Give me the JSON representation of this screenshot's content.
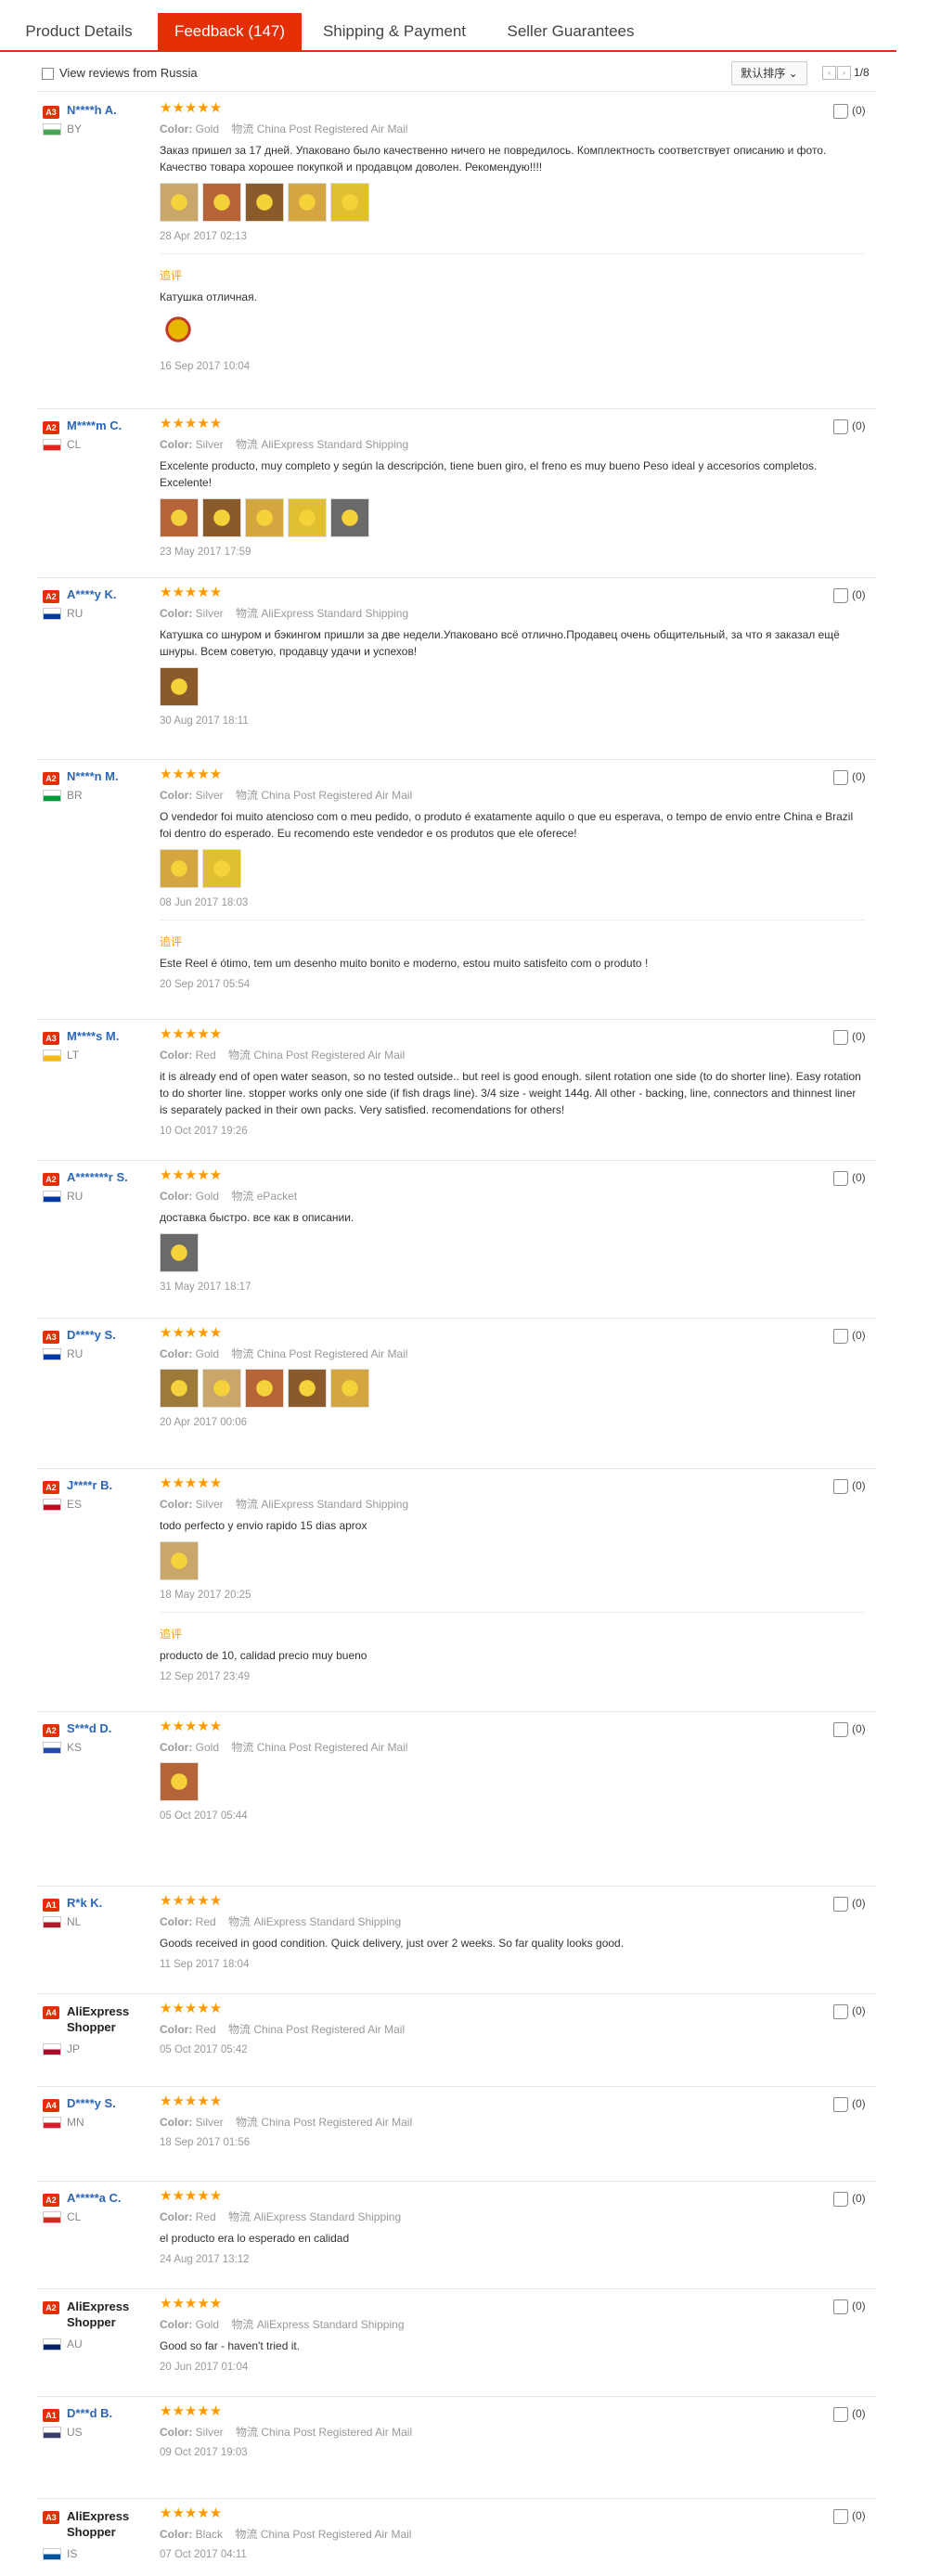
{
  "tabs": [
    {
      "label": "Product Details"
    },
    {
      "label": "Feedback (147)"
    },
    {
      "label": "Shipping & Payment"
    },
    {
      "label": "Seller Guarantees"
    }
  ],
  "toolbar": {
    "filter_label": "View reviews from Russia",
    "sort_label": "默认排序",
    "page_text": "1/8",
    "prev": "‹",
    "next": "›"
  },
  "labels": {
    "color": "Color:",
    "shipping": "物流",
    "stars": "★★★★★",
    "added": "追评"
  },
  "reviews": [
    {
      "level": "A3",
      "name": "N****h A.",
      "country": "BY",
      "flag_color": "#4aa657",
      "color": "Gold",
      "shipping": "China Post Registered Air Mail",
      "text": "Заказ пришел за 17 дней. Упаковано было качественно ничего не повредилось. Комплектность соответствует описанию и фото. Качество товара хорошее покупкой и продавцом доволен. Рекомендую!!!!",
      "photos": 5,
      "date": "28 Apr 2017 02:13",
      "helpful": "(0)",
      "followup": {
        "text": "Катушка отличная.",
        "date": "16 Sep 2017 10:04",
        "photos": 1
      }
    },
    {
      "level": "A2",
      "name": "M****m C.",
      "country": "CL",
      "flag_color": "#d52b1e",
      "color": "Silver",
      "shipping": "AliExpress Standard Shipping",
      "text": "Excelente producto, muy completo y según la descripción, tiene buen giro, el freno es muy bueno Peso ideal y accesorios completos. Excelente!",
      "photos": 5,
      "date": "23 May 2017 17:59",
      "helpful": "(0)"
    },
    {
      "level": "A2",
      "name": "A****y K.",
      "country": "RU",
      "flag_color": "#0039a6",
      "color": "Silver",
      "shipping": "AliExpress Standard Shipping",
      "text": "Катушка со шнуром и бэкингом пришли за две недели.Упаковано всё отлично.Продавец очень общительный, за что я заказал ещё шнуры. Всем советую, продавцу удачи и успехов!",
      "photos": 1,
      "date": "30 Aug 2017 18:11",
      "helpful": "(0)"
    },
    {
      "level": "A2",
      "name": "N****n M.",
      "country": "BR",
      "flag_color": "#009c3b",
      "color": "Silver",
      "shipping": "China Post Registered Air Mail",
      "text": "O vendedor foi muito atencioso com o meu pedido, o produto é exatamente aquilo o que eu esperava, o tempo de envio entre China e Brazil foi dentro do esperado. Eu recomendo este vendedor e os produtos que ele oferece!",
      "photos": 2,
      "date": "08 Jun 2017 18:03",
      "helpful": "(0)",
      "followup": {
        "text": "Este Reel é ótimo, tem um desenho muito bonito e moderno, estou muito satisfeito com o produto !",
        "date": "20 Sep 2017 05:54",
        "photos": 0
      }
    },
    {
      "level": "A3",
      "name": "M****s M.",
      "country": "LT",
      "flag_color": "#fdb913",
      "color": "Red",
      "shipping": "China Post Registered Air Mail",
      "text": "it is already end of open water season, so no tested outside.. but reel is good enough. silent rotation one side (to do shorter line). Easy rotation to do shorter line. stopper works only one side (if fish drags line). 3/4 size - weight 144g. All other - backing, line, connectors and thinnest liner is separately packed in their own packs. Very satisfied. recomendations for others!",
      "photos": 0,
      "date": "10 Oct 2017 19:26",
      "helpful": "(0)"
    },
    {
      "level": "A2",
      "name": "A*******r S.",
      "country": "RU",
      "flag_color": "#0039a6",
      "color": "Gold",
      "shipping": "ePacket",
      "text": "доставка быстро. все как в описании.",
      "photos": 1,
      "date": "31 May 2017 18:17",
      "helpful": "(0)"
    },
    {
      "level": "A3",
      "name": "D****y S.",
      "country": "RU",
      "flag_color": "#0039a6",
      "color": "Gold",
      "shipping": "China Post Registered Air Mail",
      "text": "",
      "photos": 5,
      "date": "20 Apr 2017 00:06",
      "helpful": "(0)"
    },
    {
      "level": "A2",
      "name": "J****r B.",
      "country": "ES",
      "flag_color": "#c60b1e",
      "color": "Silver",
      "shipping": "AliExpress Standard Shipping",
      "text": "todo perfecto y envio rapido 15 dias aprox",
      "photos": 1,
      "date": "18 May 2017 20:25",
      "helpful": "(0)",
      "followup": {
        "text": "producto de 10, calidad precio muy bueno",
        "date": "12 Sep 2017 23:49",
        "photos": 0
      }
    },
    {
      "level": "A2",
      "name": "S***d D.",
      "country": "KS",
      "flag_color": "#244aa5",
      "color": "Gold",
      "shipping": "China Post Registered Air Mail",
      "text": "",
      "photos": 1,
      "date": "05 Oct 2017 05:44",
      "helpful": "(0)"
    },
    {
      "level": "A1",
      "name": "R*k K.",
      "country": "NL",
      "flag_color": "#ae1c28",
      "color": "Red",
      "shipping": "AliExpress Standard Shipping",
      "text": "Goods received in good condition. Quick delivery, just over 2 weeks. So far quality looks good.",
      "photos": 0,
      "date": "11 Sep 2017 18:04",
      "helpful": "(0)"
    },
    {
      "level": "A4",
      "name": "AliExpress Shopper",
      "country": "JP",
      "flag_color": "#bc002d",
      "color": "Red",
      "shipping": "China Post Registered Air Mail",
      "text": "",
      "photos": 0,
      "date": "05 Oct 2017 05:42",
      "helpful": "(0)",
      "plain": true
    },
    {
      "level": "A4",
      "name": "D****y S.",
      "country": "MN",
      "flag_color": "#c4272f",
      "color": "Silver",
      "shipping": "China Post Registered Air Mail",
      "text": "",
      "photos": 0,
      "date": "18 Sep 2017 01:56",
      "helpful": "(0)"
    },
    {
      "level": "A2",
      "name": "A*****a C.",
      "country": "CL",
      "flag_color": "#d52b1e",
      "color": "Red",
      "shipping": "AliExpress Standard Shipping",
      "text": "el producto era lo esperado en calidad",
      "photos": 0,
      "date": "24 Aug 2017 13:12",
      "helpful": "(0)"
    },
    {
      "level": "A2",
      "name": "AliExpress Shopper",
      "country": "AU",
      "flag_color": "#012169",
      "color": "Gold",
      "shipping": "AliExpress Standard Shipping",
      "text": "Good so far - haven't tried it.",
      "photos": 0,
      "date": "20 Jun 2017 01:04",
      "helpful": "(0)",
      "plain": true
    },
    {
      "level": "A1",
      "name": "D***d B.",
      "country": "US",
      "flag_color": "#3c3b6e",
      "color": "Silver",
      "shipping": "China Post Registered Air Mail",
      "text": "",
      "photos": 0,
      "date": "09 Oct 2017 19:03",
      "helpful": "(0)"
    },
    {
      "level": "A3",
      "name": "AliExpress Shopper",
      "country": "IS",
      "flag_color": "#02529c",
      "color": "Black",
      "shipping": "China Post Registered Air Mail",
      "text": "",
      "photos": 0,
      "date": "07 Oct 2017 04:11",
      "helpful": "(0)",
      "plain": true
    }
  ]
}
